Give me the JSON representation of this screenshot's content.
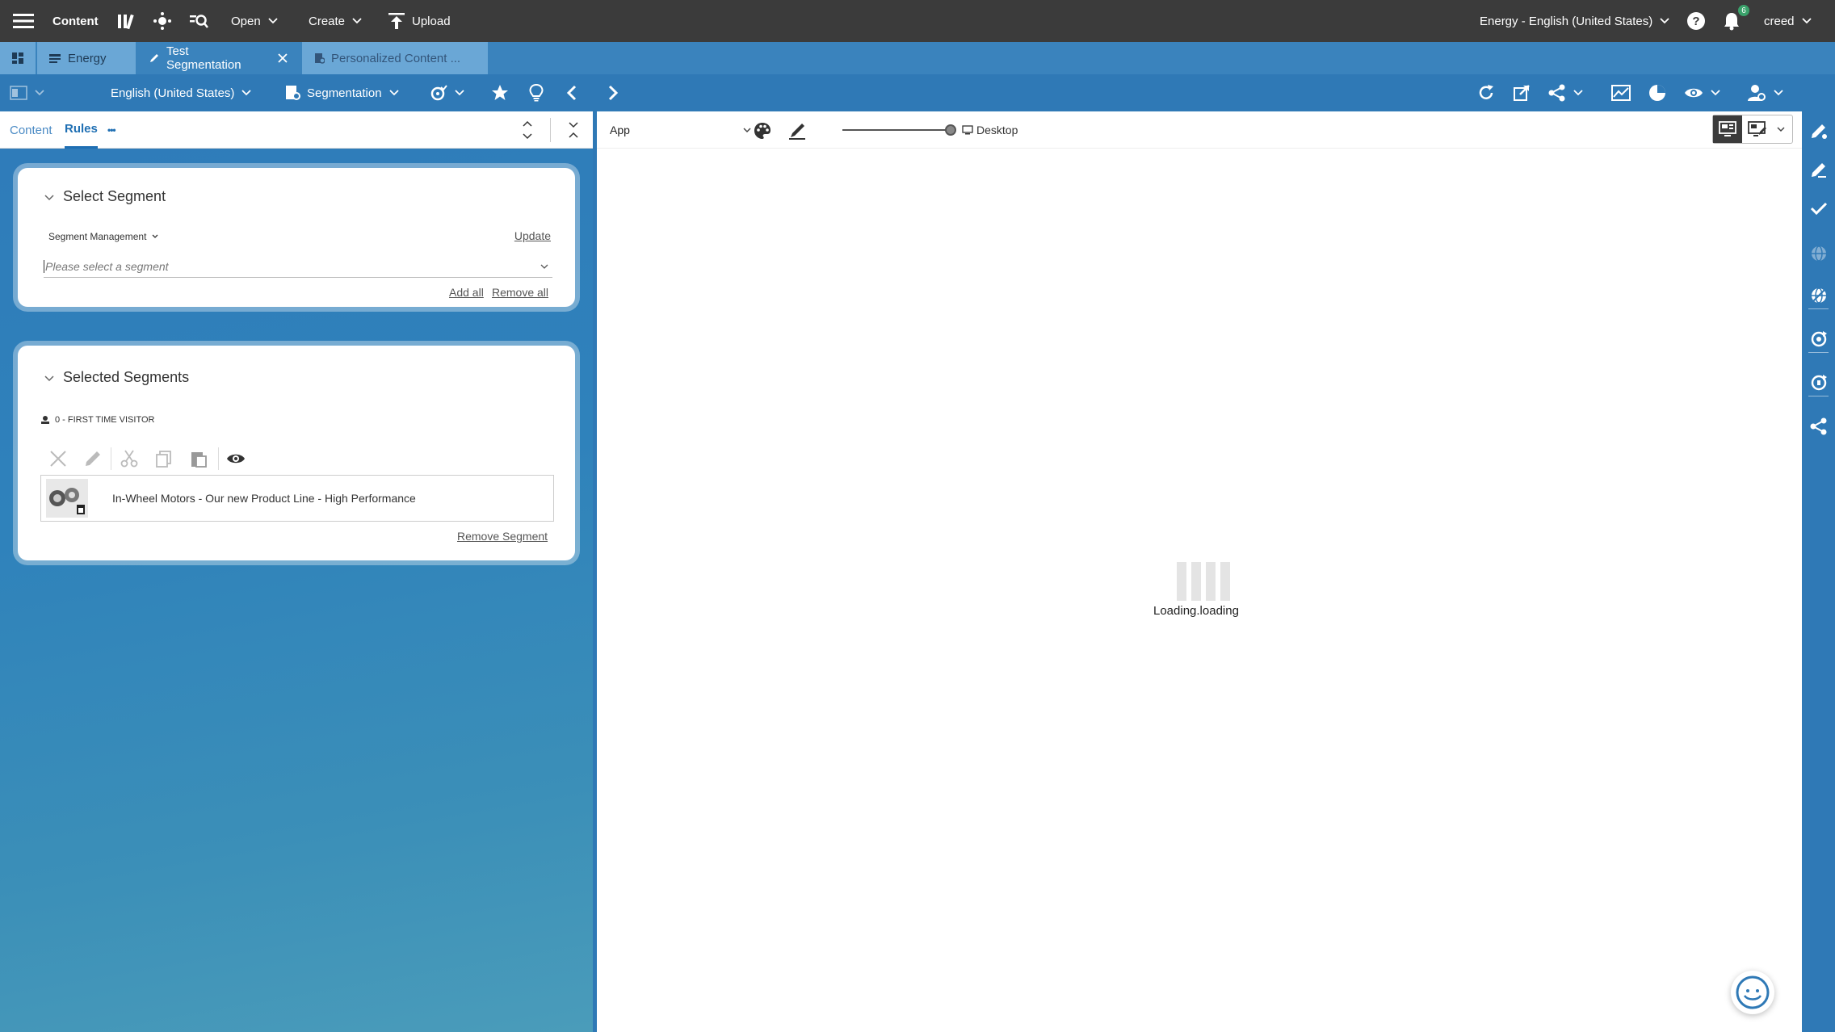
{
  "topbar": {
    "app_title": "Content",
    "open_label": "Open",
    "create_label": "Create",
    "upload_label": "Upload",
    "site_selector": "Energy - English (United States)",
    "notification_count": "6",
    "user": "creed"
  },
  "tabs": [
    {
      "label": "Energy"
    },
    {
      "label": "Test Segmentation"
    },
    {
      "label": "Personalized Content ..."
    }
  ],
  "left_toolbar": {
    "locale": "English (United States)",
    "view": "Segmentation"
  },
  "subtabs": {
    "content": "Content",
    "rules": "Rules",
    "more": "•••"
  },
  "select_segment": {
    "title": "Select Segment",
    "source": "Segment Management",
    "update": "Update",
    "placeholder": "Please select a segment",
    "add_all": "Add all",
    "remove_all": "Remove all"
  },
  "selected_segments": {
    "title": "Selected Segments",
    "segment_label": "0 - FIRST TIME VISITOR",
    "item_title": "In-Wheel Motors - Our new Product Line - High Performance",
    "remove_segment": "Remove Segment"
  },
  "preview": {
    "app_select": "App",
    "device": "Desktop",
    "loading": "Loading.loading"
  },
  "colors": {
    "topbar": "#3b3b3b",
    "toolbar_blue": "#2f79b6",
    "tab_row": "#3a83bd",
    "accent": "#1f6fb3"
  }
}
